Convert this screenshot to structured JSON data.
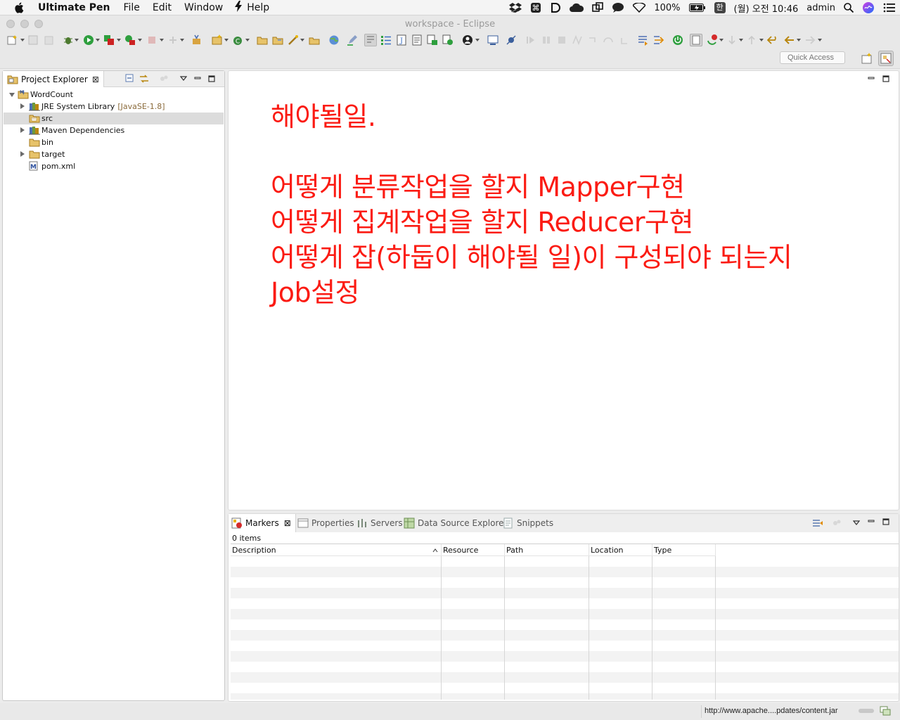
{
  "menubar": {
    "app_name": "Ultimate Pen",
    "items": [
      "File",
      "Edit",
      "Window",
      "Help"
    ]
  },
  "status": {
    "battery": "100%",
    "input_method": "한",
    "clock": "(월) 오전 10:46",
    "user": "admin"
  },
  "window": {
    "title": "workspace - Eclipse",
    "quick_access_placeholder": "Quick Access"
  },
  "project_explorer": {
    "tab_label": "Project Explorer",
    "tree": [
      {
        "label": "WordCount",
        "decoration": "",
        "level": 0,
        "twisty": "open",
        "icon": "maven-project-icon",
        "selected": false
      },
      {
        "label": "JRE System Library",
        "decoration": "[JavaSE-1.8]",
        "level": 1,
        "twisty": "closed",
        "icon": "library-icon",
        "selected": false
      },
      {
        "label": "src",
        "decoration": "",
        "level": 1,
        "twisty": "none",
        "icon": "source-folder-icon",
        "selected": true
      },
      {
        "label": "Maven Dependencies",
        "decoration": "",
        "level": 1,
        "twisty": "closed",
        "icon": "library-icon",
        "selected": false
      },
      {
        "label": "bin",
        "decoration": "",
        "level": 1,
        "twisty": "none",
        "icon": "folder-icon",
        "selected": false
      },
      {
        "label": "target",
        "decoration": "",
        "level": 1,
        "twisty": "closed",
        "icon": "folder-icon",
        "selected": false
      },
      {
        "label": "pom.xml",
        "decoration": "",
        "level": 1,
        "twisty": "none",
        "icon": "maven-pom-icon",
        "selected": false
      }
    ]
  },
  "editor": {
    "notes": [
      "해야될일.",
      "",
      "어떻게 분류작업을 할지 Mapper구현",
      "어떻게 집계작업을 할지 Reducer구현",
      "어떻게 잡(하둡이 해야될 일)이 구성되야 되는지",
      "Job설정"
    ],
    "text_color": "#fb1b13"
  },
  "bottom_panel": {
    "tabs": [
      "Markers",
      "Properties",
      "Servers",
      "Data Source Explorer",
      "Snippets"
    ],
    "active_tab": "Markers",
    "items_count": "0 items",
    "columns": [
      "Description",
      "Resource",
      "Path",
      "Location",
      "Type"
    ],
    "sort_column": "Description"
  },
  "statusbar": {
    "url": "http://www.apache....pdates/content.jar"
  }
}
